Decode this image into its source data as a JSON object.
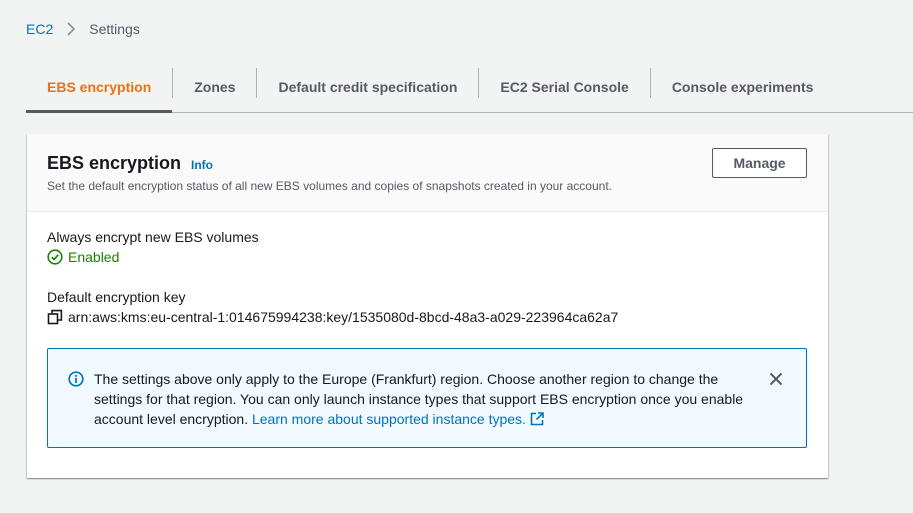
{
  "breadcrumb": {
    "root": "EC2",
    "current": "Settings"
  },
  "tabs": [
    {
      "label": "EBS encryption",
      "active": true
    },
    {
      "label": "Zones",
      "active": false
    },
    {
      "label": "Default credit specification",
      "active": false
    },
    {
      "label": "EC2 Serial Console",
      "active": false
    },
    {
      "label": "Console experiments",
      "active": false
    }
  ],
  "card": {
    "title": "EBS encryption",
    "info_label": "Info",
    "description": "Set the default encryption status of all new EBS volumes and copies of snapshots created in your account.",
    "manage_label": "Manage"
  },
  "encrypt_setting": {
    "label": "Always encrypt new EBS volumes",
    "status": "Enabled"
  },
  "encryption_key": {
    "label": "Default encryption key",
    "value": "arn:aws:kms:eu-central-1:014675994238:key/1535080d-8bcd-48a3-a029-223964ca62a7"
  },
  "alert": {
    "text": "The settings above only apply to the Europe (Frankfurt) region. Choose another region to change the settings for that region. You can only launch instance types that support EBS encryption once you enable account level encryption.",
    "link": "Learn more about supported instance types."
  },
  "colors": {
    "accent": "#ec7211",
    "link": "#0073bb",
    "success": "#1d8102",
    "info_bg": "#f1faff"
  },
  "icons": [
    "chevron-right-icon",
    "check-circle-icon",
    "copy-icon",
    "info-circle-icon",
    "external-link-icon",
    "close-icon"
  ]
}
